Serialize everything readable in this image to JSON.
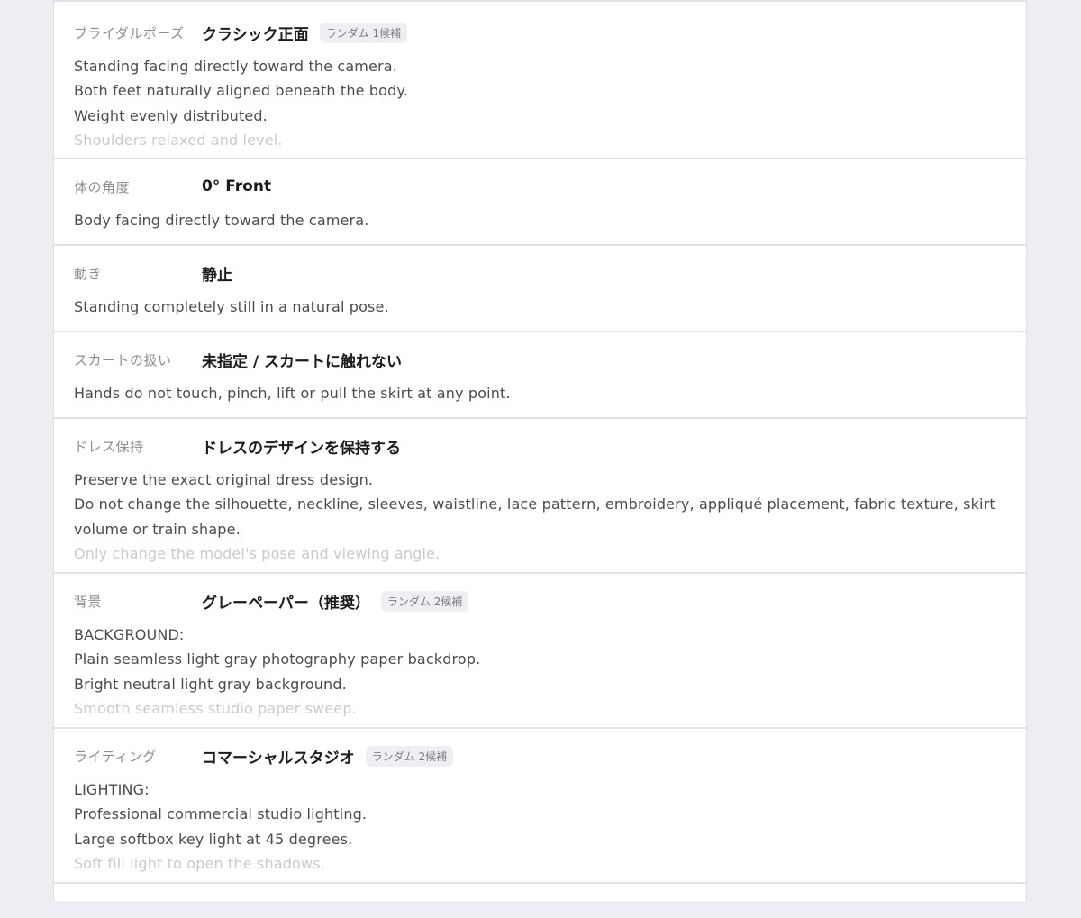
{
  "sections": [
    {
      "label": "ブライダルポーズ",
      "value": "クラシック正面",
      "badge": "ランダム 1候補",
      "lines": [
        "Standing facing directly toward the camera.",
        "Both feet naturally aligned beneath the body.",
        "Weight evenly distributed.",
        "Shoulders relaxed and level."
      ]
    },
    {
      "label": "体の角度",
      "value": "0° Front",
      "lines": [
        "Body facing directly toward the camera."
      ]
    },
    {
      "label": "動き",
      "value": "静止",
      "lines": [
        "Standing completely still in a natural pose."
      ]
    },
    {
      "label": "スカートの扱い",
      "value": "未指定 / スカートに触れない",
      "lines": [
        "Hands do not touch, pinch, lift or pull the skirt at any point."
      ]
    },
    {
      "label": "ドレス保持",
      "value": "ドレスのデザインを保持する",
      "lines": [
        "Preserve the exact original dress design.",
        "Do not change the silhouette, neckline, sleeves, waistline, lace pattern, embroidery, appliqué placement, fabric texture, skirt volume or train shape.",
        "Only change the model's pose and viewing angle."
      ]
    },
    {
      "label": "背景",
      "value": "グレーペーパー（推奨）",
      "badge": "ランダム 2候補",
      "lines": [
        "BACKGROUND:",
        "Plain seamless light gray photography paper backdrop.",
        "Bright neutral light gray background.",
        "Smooth seamless studio paper sweep."
      ]
    },
    {
      "label": "ライティング",
      "value": "コマーシャルスタジオ",
      "badge": "ランダム 2候補",
      "lines": [
        "LIGHTING:",
        "Professional commercial studio lighting.",
        "Large softbox key light at 45 degrees.",
        "Soft fill light to open the shadows."
      ]
    }
  ]
}
